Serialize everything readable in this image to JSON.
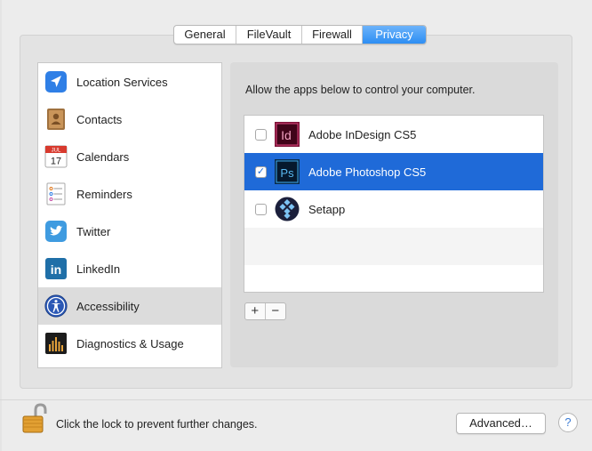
{
  "tabs": [
    {
      "label": "General",
      "active": false
    },
    {
      "label": "FileVault",
      "active": false
    },
    {
      "label": "Firewall",
      "active": false
    },
    {
      "label": "Privacy",
      "active": true
    }
  ],
  "sidebar": {
    "items": [
      {
        "label": "Location Services",
        "icon": "location-arrow-icon"
      },
      {
        "label": "Contacts",
        "icon": "contacts-book-icon"
      },
      {
        "label": "Calendars",
        "icon": "calendar-icon",
        "icon_text": "JUL",
        "icon_day": "17"
      },
      {
        "label": "Reminders",
        "icon": "reminders-list-icon"
      },
      {
        "label": "Twitter",
        "icon": "twitter-bird-icon"
      },
      {
        "label": "LinkedIn",
        "icon": "linkedin-icon",
        "icon_text": "in"
      },
      {
        "label": "Accessibility",
        "icon": "accessibility-person-icon",
        "selected": true
      },
      {
        "label": "Diagnostics & Usage",
        "icon": "diagnostics-bars-icon"
      }
    ]
  },
  "privacy": {
    "prompt": "Allow the apps below to control your computer.",
    "apps": [
      {
        "label": "Adobe InDesign CS5",
        "checked": false,
        "icon": "indesign-icon",
        "icon_text": "Id"
      },
      {
        "label": "Adobe Photoshop CS5",
        "checked": true,
        "selected": true,
        "icon": "photoshop-icon",
        "icon_text": "Ps"
      },
      {
        "label": "Setapp",
        "checked": false,
        "icon": "setapp-icon"
      }
    ],
    "check_mark": "✓",
    "add_label": "+",
    "remove_label": "−"
  },
  "footer": {
    "lock_text": "Click the lock to prevent further changes.",
    "advanced_label": "Advanced…",
    "help_label": "?"
  },
  "colors": {
    "accent": "#2d8ef3",
    "selection": "#1f6ad8",
    "sidebar_selected": "#dcdcdc",
    "pane_background": "#e3e3e3"
  }
}
